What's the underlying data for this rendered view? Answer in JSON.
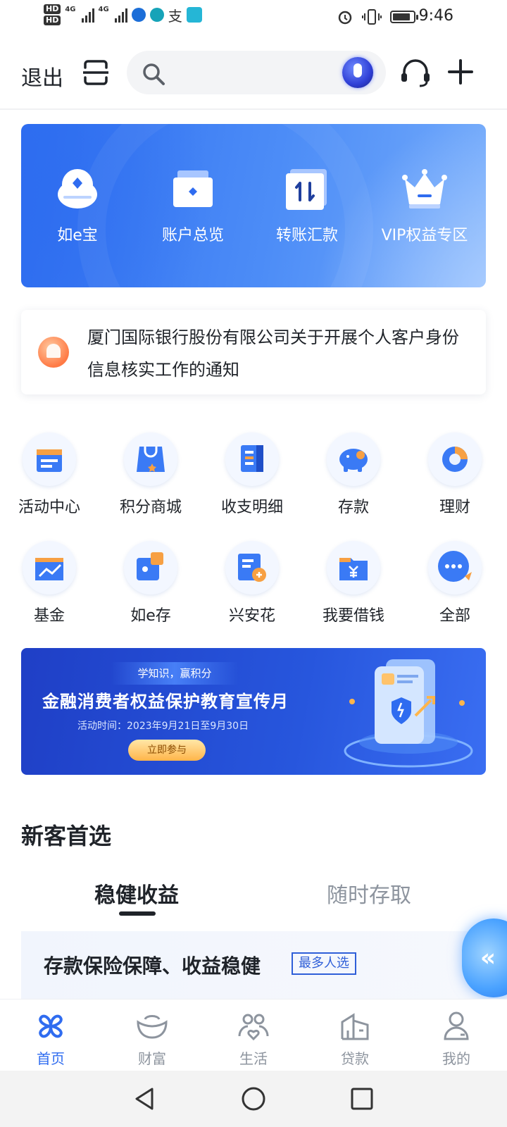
{
  "status_bar": {
    "time": "9:46",
    "hd1": "HD",
    "hd2": "HD",
    "net1": "4G",
    "net2": "4G",
    "icons": [
      "signal-icon",
      "wifi-icon",
      "alipay-icon",
      "reader-icon",
      "alarm-icon",
      "vibrate-icon",
      "battery-icon"
    ]
  },
  "header": {
    "exit_label": "退出",
    "search_placeholder": "",
    "icons": [
      "scan-icon",
      "search-icon",
      "voice-icon",
      "customer-service-icon",
      "plus-icon"
    ]
  },
  "quick_actions": [
    {
      "label": "如e宝",
      "icon": "wallet-icon"
    },
    {
      "label": "账户总览",
      "icon": "account-icon"
    },
    {
      "label": "转账汇款",
      "icon": "transfer-icon"
    },
    {
      "label": "VIP权益专区",
      "icon": "crown-icon"
    }
  ],
  "notice": {
    "text": "厦门国际银行股份有限公司关于开展个人客户身份信息核实工作的通知",
    "icon": "bell-icon"
  },
  "services": [
    {
      "label": "活动中心",
      "icon": "calendar-icon"
    },
    {
      "label": "积分商城",
      "icon": "shopping-bag-icon"
    },
    {
      "label": "收支明细",
      "icon": "ledger-icon"
    },
    {
      "label": "存款",
      "icon": "piggy-bank-icon"
    },
    {
      "label": "理财",
      "icon": "pie-chart-icon"
    },
    {
      "label": "基金",
      "icon": "fund-folder-icon"
    },
    {
      "label": "如e存",
      "icon": "puzzle-icon"
    },
    {
      "label": "兴安花",
      "icon": "card-icon"
    },
    {
      "label": "我要借钱",
      "icon": "loan-folder-icon"
    },
    {
      "label": "全部",
      "icon": "more-icon"
    }
  ],
  "banner": {
    "tag": "学知识，赢积分",
    "title": "金融消费者权益保护教育宣传月",
    "date": "活动时间：2023年9月21日至9月30日",
    "button": "立即参与"
  },
  "new_customer": {
    "title": "新客首选",
    "tabs": [
      "稳健收益",
      "随时存取"
    ],
    "active_tab": 0,
    "promo_text": "存款保险保障、收益稳健",
    "promo_badge": "最多人选"
  },
  "bottom_nav": [
    {
      "label": "首页",
      "icon": "home-icon",
      "active": true
    },
    {
      "label": "财富",
      "icon": "wealth-icon",
      "active": false
    },
    {
      "label": "生活",
      "icon": "life-icon",
      "active": false
    },
    {
      "label": "贷款",
      "icon": "loan-icon",
      "active": false
    },
    {
      "label": "我的",
      "icon": "profile-icon",
      "active": false
    }
  ],
  "colors": {
    "brand_blue": "#2f6cf0",
    "text_primary": "#1f2329",
    "text_secondary": "#8d949e",
    "notice_orange": "#ff7a45"
  }
}
